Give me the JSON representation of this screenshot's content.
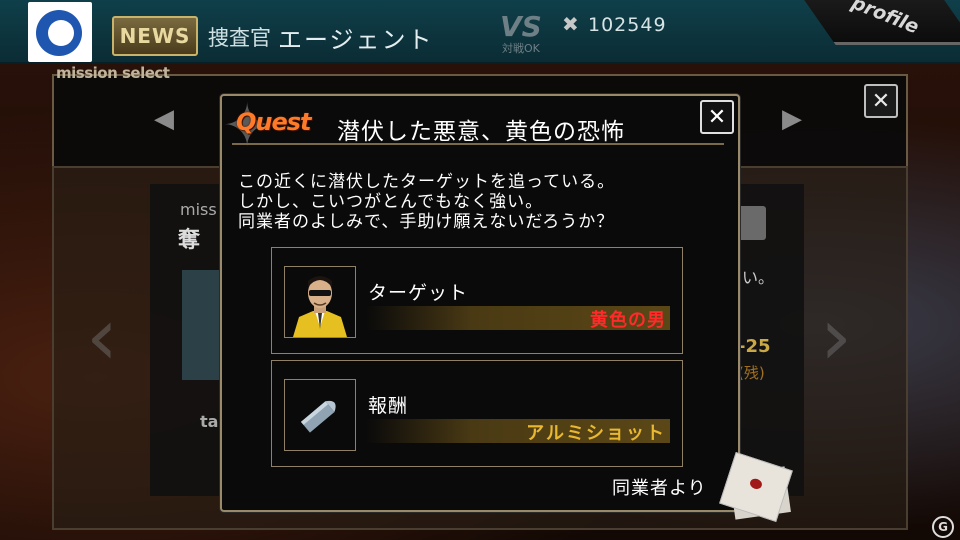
{
  "header": {
    "news_label": "NEWS",
    "rank": "捜査官",
    "agent_name": "エージェント",
    "vs_logo": "VS",
    "vs_sub": "対戦OK",
    "points": "102549",
    "profile_label": "profile"
  },
  "mission_select": {
    "label": "mission select"
  },
  "background_card": {
    "mission_text": "miss",
    "title_fragment": "奪",
    "side_text": "い。",
    "date_fragment": "-25",
    "sub_fragment": "(残)",
    "ta_text": "ta"
  },
  "quest": {
    "logo": "Quest",
    "title": "潜伏した悪意、黄色の恐怖",
    "description": [
      "この近くに潜伏したターゲットを追っている。",
      "しかし、こいつがとんでもなく強い。",
      "同業者のよしみで、手助け願えないだろうか？"
    ],
    "target_label": "ターゲット",
    "target_value": "黄色の男",
    "reward_label": "報酬",
    "reward_value": "アルミショット",
    "from_label": "同業者より"
  },
  "colors": {
    "quest_logo": "#ff7a28",
    "target_value": "#ff2a2a",
    "reward_value": "#e8b830",
    "topbar": "#0f3f4a",
    "dialog_border": "#9b8a6a"
  },
  "icons": {
    "close": "close-icon",
    "left_arrow": "arrow-left-icon",
    "right_arrow": "arrow-right-icon",
    "letter": "letter-icon",
    "bullet": "bullet-icon",
    "man_portrait": "yellow-man-portrait"
  }
}
